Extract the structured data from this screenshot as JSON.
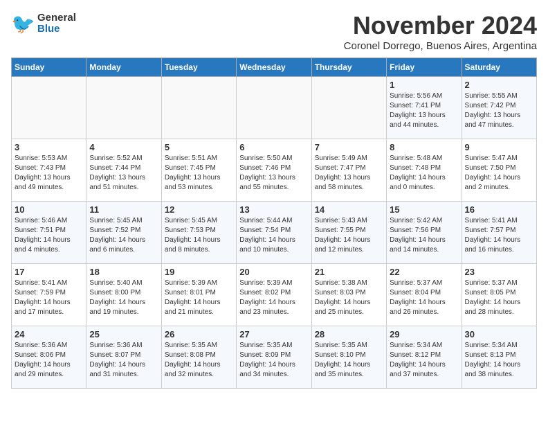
{
  "logo": {
    "general": "General",
    "blue": "Blue"
  },
  "title": "November 2024",
  "subtitle": "Coronel Dorrego, Buenos Aires, Argentina",
  "weekdays": [
    "Sunday",
    "Monday",
    "Tuesday",
    "Wednesday",
    "Thursday",
    "Friday",
    "Saturday"
  ],
  "weeks": [
    [
      {
        "day": "",
        "info": ""
      },
      {
        "day": "",
        "info": ""
      },
      {
        "day": "",
        "info": ""
      },
      {
        "day": "",
        "info": ""
      },
      {
        "day": "",
        "info": ""
      },
      {
        "day": "1",
        "info": "Sunrise: 5:56 AM\nSunset: 7:41 PM\nDaylight: 13 hours\nand 44 minutes."
      },
      {
        "day": "2",
        "info": "Sunrise: 5:55 AM\nSunset: 7:42 PM\nDaylight: 13 hours\nand 47 minutes."
      }
    ],
    [
      {
        "day": "3",
        "info": "Sunrise: 5:53 AM\nSunset: 7:43 PM\nDaylight: 13 hours\nand 49 minutes."
      },
      {
        "day": "4",
        "info": "Sunrise: 5:52 AM\nSunset: 7:44 PM\nDaylight: 13 hours\nand 51 minutes."
      },
      {
        "day": "5",
        "info": "Sunrise: 5:51 AM\nSunset: 7:45 PM\nDaylight: 13 hours\nand 53 minutes."
      },
      {
        "day": "6",
        "info": "Sunrise: 5:50 AM\nSunset: 7:46 PM\nDaylight: 13 hours\nand 55 minutes."
      },
      {
        "day": "7",
        "info": "Sunrise: 5:49 AM\nSunset: 7:47 PM\nDaylight: 13 hours\nand 58 minutes."
      },
      {
        "day": "8",
        "info": "Sunrise: 5:48 AM\nSunset: 7:48 PM\nDaylight: 14 hours\nand 0 minutes."
      },
      {
        "day": "9",
        "info": "Sunrise: 5:47 AM\nSunset: 7:50 PM\nDaylight: 14 hours\nand 2 minutes."
      }
    ],
    [
      {
        "day": "10",
        "info": "Sunrise: 5:46 AM\nSunset: 7:51 PM\nDaylight: 14 hours\nand 4 minutes."
      },
      {
        "day": "11",
        "info": "Sunrise: 5:45 AM\nSunset: 7:52 PM\nDaylight: 14 hours\nand 6 minutes."
      },
      {
        "day": "12",
        "info": "Sunrise: 5:45 AM\nSunset: 7:53 PM\nDaylight: 14 hours\nand 8 minutes."
      },
      {
        "day": "13",
        "info": "Sunrise: 5:44 AM\nSunset: 7:54 PM\nDaylight: 14 hours\nand 10 minutes."
      },
      {
        "day": "14",
        "info": "Sunrise: 5:43 AM\nSunset: 7:55 PM\nDaylight: 14 hours\nand 12 minutes."
      },
      {
        "day": "15",
        "info": "Sunrise: 5:42 AM\nSunset: 7:56 PM\nDaylight: 14 hours\nand 14 minutes."
      },
      {
        "day": "16",
        "info": "Sunrise: 5:41 AM\nSunset: 7:57 PM\nDaylight: 14 hours\nand 16 minutes."
      }
    ],
    [
      {
        "day": "17",
        "info": "Sunrise: 5:41 AM\nSunset: 7:59 PM\nDaylight: 14 hours\nand 17 minutes."
      },
      {
        "day": "18",
        "info": "Sunrise: 5:40 AM\nSunset: 8:00 PM\nDaylight: 14 hours\nand 19 minutes."
      },
      {
        "day": "19",
        "info": "Sunrise: 5:39 AM\nSunset: 8:01 PM\nDaylight: 14 hours\nand 21 minutes."
      },
      {
        "day": "20",
        "info": "Sunrise: 5:39 AM\nSunset: 8:02 PM\nDaylight: 14 hours\nand 23 minutes."
      },
      {
        "day": "21",
        "info": "Sunrise: 5:38 AM\nSunset: 8:03 PM\nDaylight: 14 hours\nand 25 minutes."
      },
      {
        "day": "22",
        "info": "Sunrise: 5:37 AM\nSunset: 8:04 PM\nDaylight: 14 hours\nand 26 minutes."
      },
      {
        "day": "23",
        "info": "Sunrise: 5:37 AM\nSunset: 8:05 PM\nDaylight: 14 hours\nand 28 minutes."
      }
    ],
    [
      {
        "day": "24",
        "info": "Sunrise: 5:36 AM\nSunset: 8:06 PM\nDaylight: 14 hours\nand 29 minutes."
      },
      {
        "day": "25",
        "info": "Sunrise: 5:36 AM\nSunset: 8:07 PM\nDaylight: 14 hours\nand 31 minutes."
      },
      {
        "day": "26",
        "info": "Sunrise: 5:35 AM\nSunset: 8:08 PM\nDaylight: 14 hours\nand 32 minutes."
      },
      {
        "day": "27",
        "info": "Sunrise: 5:35 AM\nSunset: 8:09 PM\nDaylight: 14 hours\nand 34 minutes."
      },
      {
        "day": "28",
        "info": "Sunrise: 5:35 AM\nSunset: 8:10 PM\nDaylight: 14 hours\nand 35 minutes."
      },
      {
        "day": "29",
        "info": "Sunrise: 5:34 AM\nSunset: 8:12 PM\nDaylight: 14 hours\nand 37 minutes."
      },
      {
        "day": "30",
        "info": "Sunrise: 5:34 AM\nSunset: 8:13 PM\nDaylight: 14 hours\nand 38 minutes."
      }
    ]
  ]
}
